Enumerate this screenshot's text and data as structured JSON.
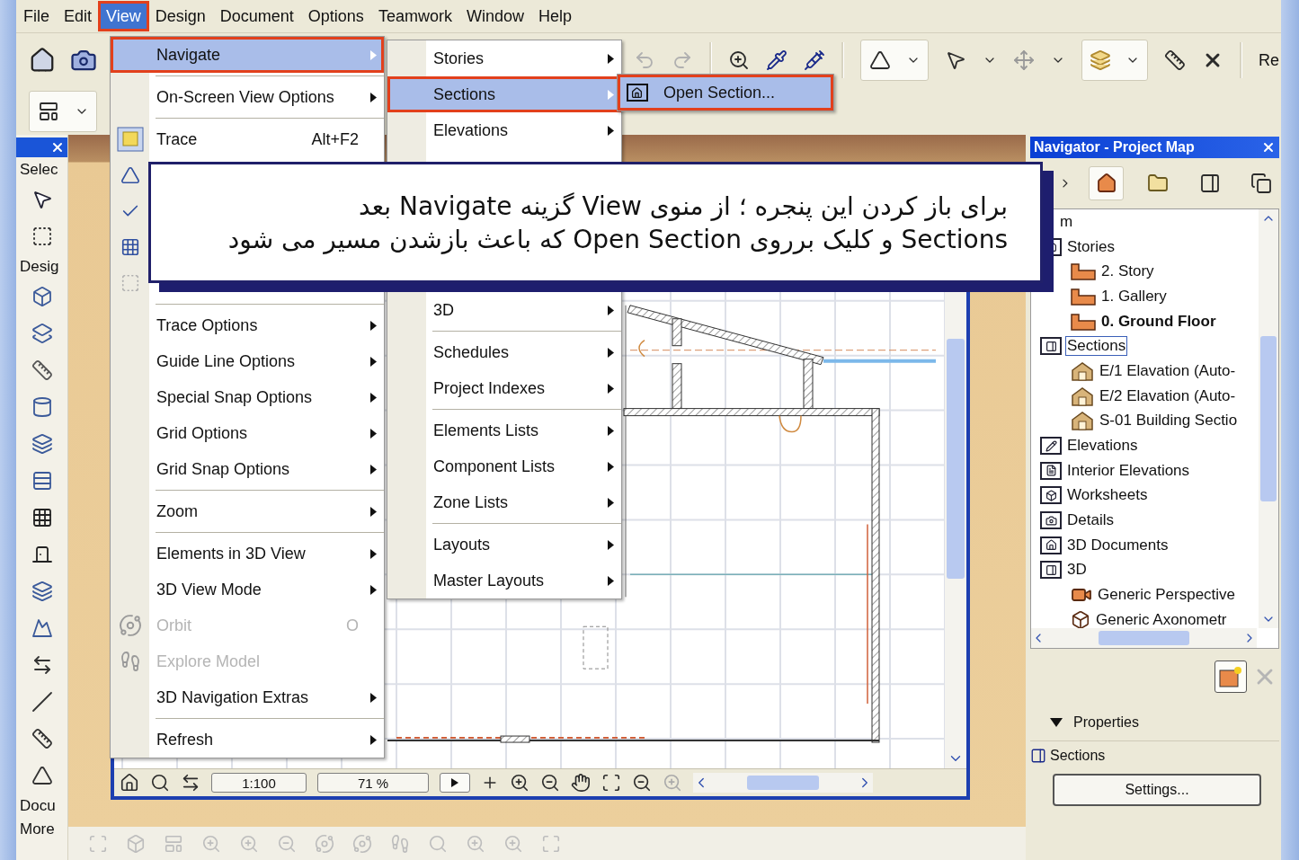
{
  "menubar": [
    {
      "label": "File",
      "selected": false
    },
    {
      "label": "Edit",
      "selected": false
    },
    {
      "label": "View",
      "selected": true
    },
    {
      "label": "Design",
      "selected": false
    },
    {
      "label": "Document",
      "selected": false
    },
    {
      "label": "Options",
      "selected": false
    },
    {
      "label": "Teamwork",
      "selected": false
    },
    {
      "label": "Window",
      "selected": false
    },
    {
      "label": "Help",
      "selected": false
    }
  ],
  "toolbar": {
    "cut_label": "Re"
  },
  "toolbox": {
    "sections": [
      {
        "label": "Selec"
      },
      {
        "label": "Desig"
      },
      {
        "label": "Docu"
      },
      {
        "label": "More"
      }
    ]
  },
  "view_menu": {
    "items": [
      {
        "kind": "submenu",
        "label": "Navigate",
        "selected": true,
        "disabled": false
      },
      {
        "kind": "separator"
      },
      {
        "kind": "submenu",
        "label": "On-Screen View Options",
        "selected": false,
        "disabled": false
      },
      {
        "kind": "separator"
      },
      {
        "kind": "command",
        "label": "Trace",
        "shortcut": "Alt+F2",
        "selected": false,
        "disabled": false
      },
      {
        "kind": "covered"
      },
      {
        "kind": "covered"
      },
      {
        "kind": "covered"
      },
      {
        "kind": "covered"
      },
      {
        "kind": "separator"
      },
      {
        "kind": "submenu",
        "label": "Trace Options",
        "selected": false,
        "disabled": false
      },
      {
        "kind": "submenu",
        "label": "Guide Line Options",
        "selected": false,
        "disabled": false
      },
      {
        "kind": "submenu",
        "label": "Special Snap Options",
        "selected": false,
        "disabled": false
      },
      {
        "kind": "submenu",
        "label": "Grid Options",
        "selected": false,
        "disabled": false
      },
      {
        "kind": "submenu",
        "label": "Grid Snap Options",
        "selected": false,
        "disabled": false
      },
      {
        "kind": "separator"
      },
      {
        "kind": "submenu",
        "label": "Zoom",
        "selected": false,
        "disabled": false
      },
      {
        "kind": "separator"
      },
      {
        "kind": "submenu",
        "label": "Elements in 3D View",
        "selected": false,
        "disabled": false
      },
      {
        "kind": "submenu",
        "label": "3D View Mode",
        "selected": false,
        "disabled": false
      },
      {
        "kind": "command",
        "label": "Orbit",
        "shortcut": "O",
        "selected": false,
        "disabled": true
      },
      {
        "kind": "command",
        "label": "Explore Model",
        "selected": false,
        "disabled": true
      },
      {
        "kind": "submenu",
        "label": "3D Navigation Extras",
        "selected": false,
        "disabled": false
      },
      {
        "kind": "separator"
      },
      {
        "kind": "submenu",
        "label": "Refresh",
        "selected": false,
        "disabled": false
      }
    ]
  },
  "navigate_menu": {
    "items": [
      {
        "kind": "submenu",
        "label": "Stories",
        "selected": false,
        "disabled": false
      },
      {
        "kind": "submenu",
        "label": "Sections",
        "selected": true,
        "disabled": false
      },
      {
        "kind": "submenu",
        "label": "Elevations",
        "selected": false,
        "disabled": false
      },
      {
        "kind": "covered"
      },
      {
        "kind": "covered"
      },
      {
        "kind": "covered"
      },
      {
        "kind": "covered"
      },
      {
        "kind": "submenu",
        "label": "3D",
        "selected": false,
        "disabled": false
      },
      {
        "kind": "separator"
      },
      {
        "kind": "submenu",
        "label": "Schedules",
        "selected": false,
        "disabled": false
      },
      {
        "kind": "submenu",
        "label": "Project Indexes",
        "selected": false,
        "disabled": false
      },
      {
        "kind": "separator"
      },
      {
        "kind": "submenu",
        "label": "Elements Lists",
        "selected": false,
        "disabled": false
      },
      {
        "kind": "submenu",
        "label": "Component Lists",
        "selected": false,
        "disabled": false
      },
      {
        "kind": "submenu",
        "label": "Zone Lists",
        "selected": false,
        "disabled": false
      },
      {
        "kind": "separator"
      },
      {
        "kind": "submenu",
        "label": "Layouts",
        "selected": false,
        "disabled": false
      },
      {
        "kind": "submenu",
        "label": "Master Layouts",
        "selected": false,
        "disabled": false
      }
    ]
  },
  "sections_menu": {
    "items": [
      {
        "kind": "command",
        "label": "Open Section...",
        "selected": true,
        "disabled": false
      }
    ]
  },
  "annotation": {
    "lines": [
      "برای باز کردن این پنجره ؛ از منوی View گزینه Navigate بعد",
      "Sections و کلیک برروی Open Section که باعث بازشدن مسیر می شود"
    ]
  },
  "drawing_window": {
    "scale": "1:100",
    "zoom": "71 %"
  },
  "navigator": {
    "title": "Navigator - Project Map",
    "tree": [
      {
        "label": "m",
        "kind": "root",
        "selected": false,
        "children": [
          {
            "label": "Stories",
            "kind": "group",
            "selected": false,
            "children": [
              {
                "label": "2. Story",
                "kind": "story",
                "selected": false,
                "current": false
              },
              {
                "label": "1. Gallery",
                "kind": "story",
                "selected": false,
                "current": false
              },
              {
                "label": "0. Ground Floor",
                "kind": "story",
                "selected": false,
                "current": true
              }
            ]
          },
          {
            "label": "Sections",
            "kind": "group",
            "selected": true,
            "children": [
              {
                "label": "E/1 Elavation (Auto-",
                "kind": "view",
                "selected": false
              },
              {
                "label": "E/2 Elavation (Auto-",
                "kind": "view",
                "selected": false
              },
              {
                "label": "S-01 Building Sectio",
                "kind": "view",
                "selected": false
              }
            ]
          },
          {
            "label": "Elevations",
            "kind": "group",
            "selected": false
          },
          {
            "label": "Interior Elevations",
            "kind": "group",
            "selected": false
          },
          {
            "label": "Worksheets",
            "kind": "group",
            "selected": false
          },
          {
            "label": "Details",
            "kind": "group",
            "selected": false
          },
          {
            "label": "3D Documents",
            "kind": "group",
            "selected": false
          },
          {
            "label": "3D",
            "kind": "group",
            "selected": false,
            "children": [
              {
                "label": "Generic Perspective",
                "kind": "camera",
                "selected": false
              },
              {
                "label": "Generic Axonometr",
                "kind": "axonometry",
                "selected": false
              }
            ]
          }
        ]
      }
    ],
    "properties": {
      "label": "Properties",
      "expanded": true
    },
    "context": "Sections",
    "settings_button": "Settings..."
  }
}
